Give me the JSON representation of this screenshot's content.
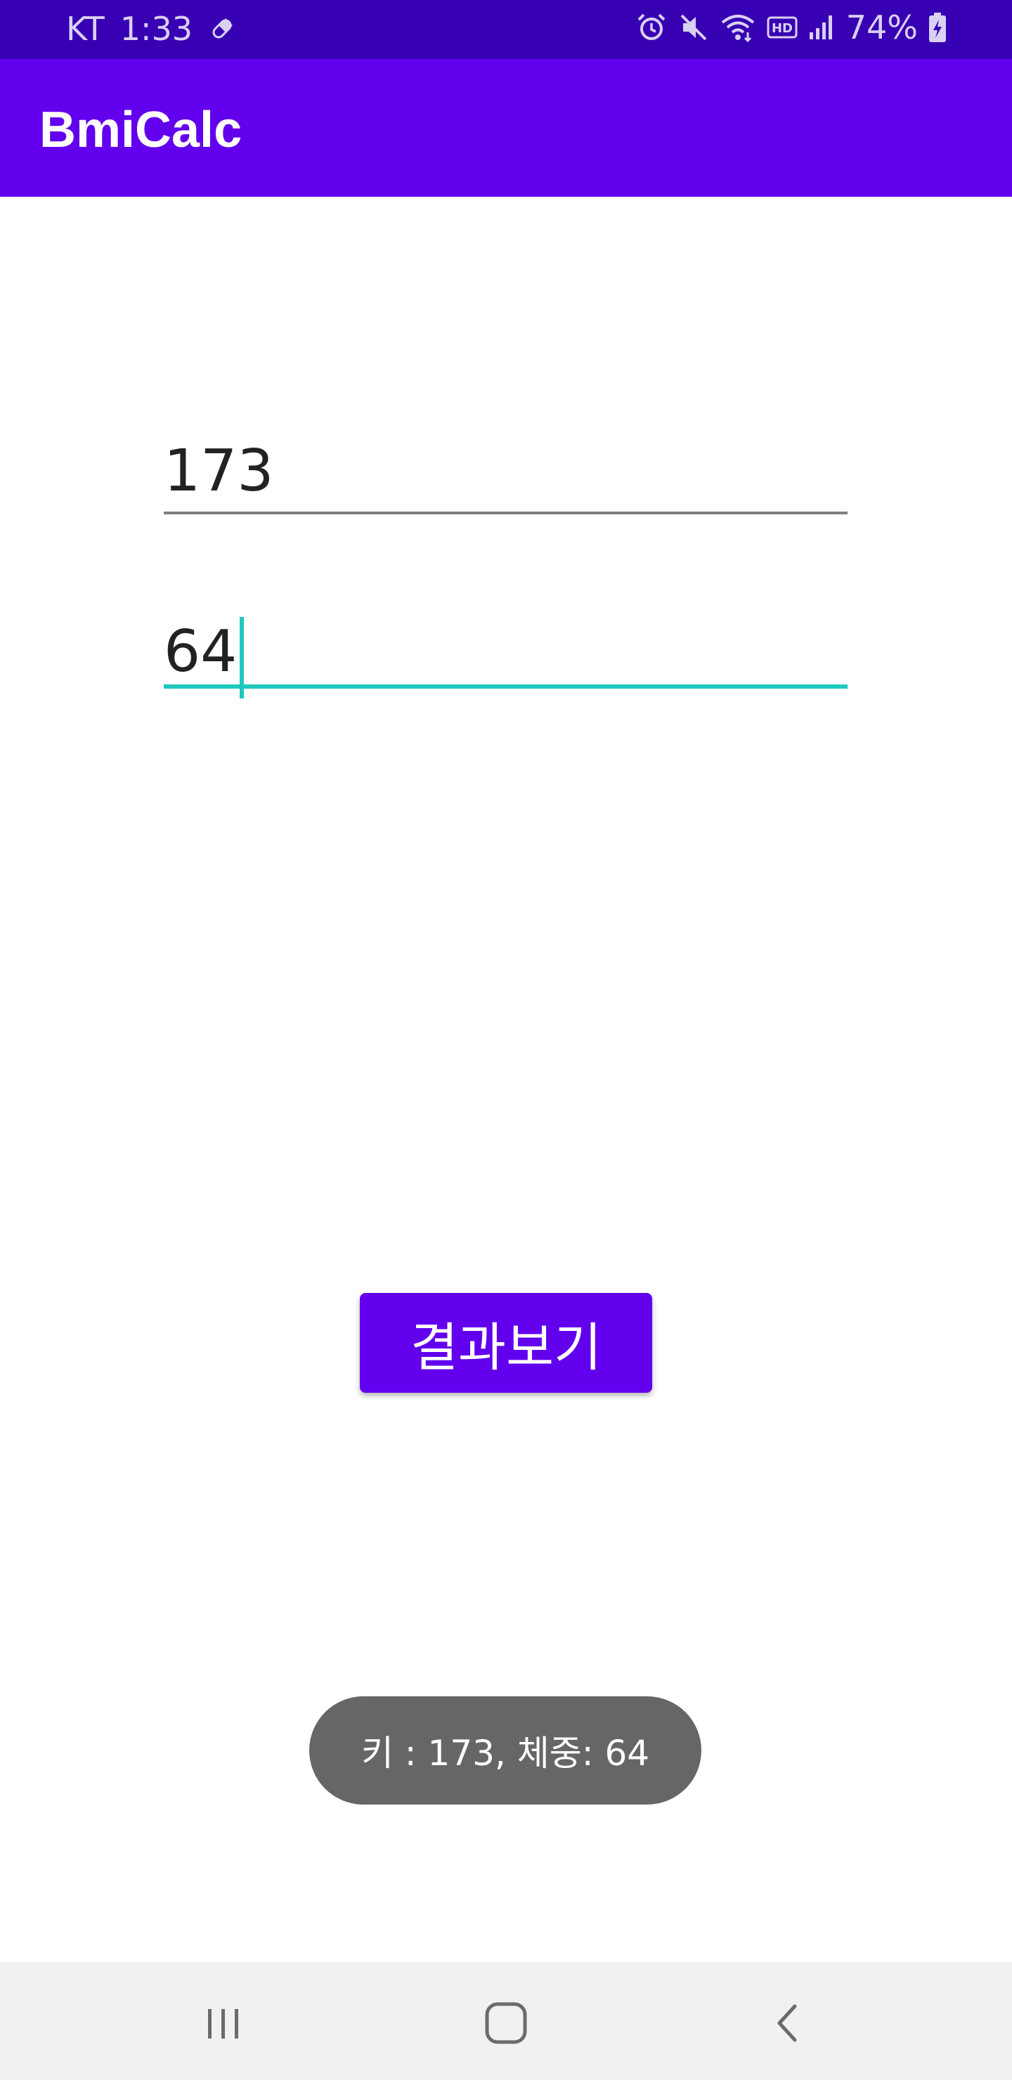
{
  "status_bar": {
    "carrier": "KT",
    "time": "1:33",
    "battery": "74%",
    "icons": [
      "pill-icon",
      "alarm-icon",
      "mute-icon",
      "wifi-icon",
      "hd-icon",
      "signal-icon",
      "battery-charging-icon"
    ]
  },
  "app_bar": {
    "title": "BmiCalc"
  },
  "form": {
    "height_value": "173",
    "weight_value": "64"
  },
  "button": {
    "label": "결과보기"
  },
  "toast": {
    "message": "키 : 173, 체중: 64"
  },
  "nav_bar": {
    "icons": [
      "recent-apps-icon",
      "home-icon",
      "back-icon"
    ]
  },
  "colors": {
    "status_bar": "#3700b3",
    "primary": "#6200ee",
    "accent": "#1ec8be",
    "toast": "#666666",
    "nav_bar": "#f1f1f1"
  }
}
